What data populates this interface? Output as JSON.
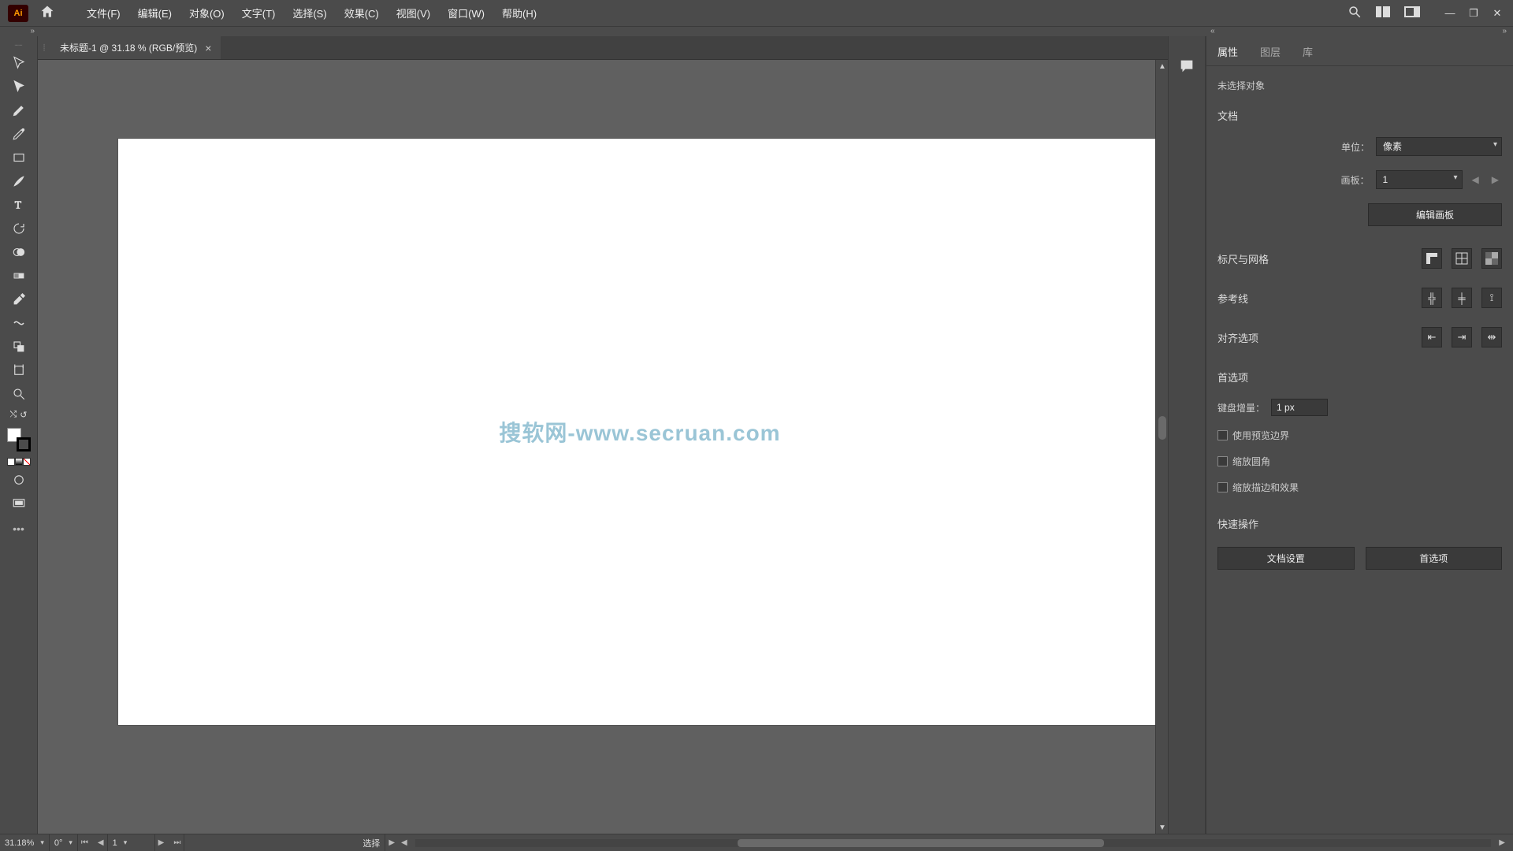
{
  "app": {
    "logo_text": "Ai"
  },
  "menubar": {
    "items": [
      "文件(F)",
      "编辑(E)",
      "对象(O)",
      "文字(T)",
      "选择(S)",
      "效果(C)",
      "视图(V)",
      "窗口(W)",
      "帮助(H)"
    ]
  },
  "doc_tab": {
    "title": "未标题-1 @ 31.18 % (RGB/预览)"
  },
  "watermark": "搜软网-www.secruan.com",
  "right_panel": {
    "tabs": [
      "属性",
      "图层",
      "库"
    ],
    "no_selection": "未选择对象",
    "section_document": "文档",
    "unit_label": "单位：",
    "unit_value": "像素",
    "artboard_label": "画板：",
    "artboard_value": "1",
    "edit_artboards_btn": "编辑画板",
    "section_rulers": "标尺与网格",
    "section_guides": "参考线",
    "section_align": "对齐选项",
    "section_prefs": "首选项",
    "key_increment_label": "键盘增量：",
    "key_increment_value": "1 px",
    "cb_preview_bounds": "使用预览边界",
    "cb_scale_corners": "缩放圆角",
    "cb_scale_strokes": "缩放描边和效果",
    "section_quick": "快速操作",
    "quick_doc_setup": "文档设置",
    "quick_prefs": "首选项"
  },
  "statusbar": {
    "zoom": "31.18%",
    "rotate": "0°",
    "artboard_nav": "1",
    "current_tool": "选择"
  }
}
